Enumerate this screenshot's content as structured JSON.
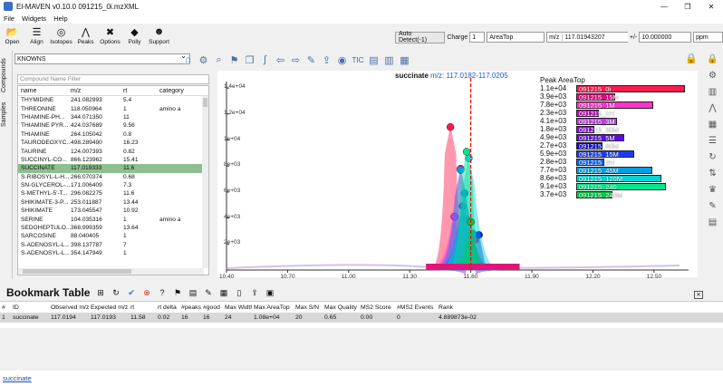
{
  "window": {
    "title": "El-MAVEN v0.10.0 091215_0i.mzXML",
    "min": "—",
    "max": "❐",
    "close": "✕"
  },
  "menu": [
    "File",
    "Widgets",
    "Help"
  ],
  "toolbar": [
    {
      "label": "Open",
      "icon": "folder-icon",
      "glyph": "📂"
    },
    {
      "label": "Align",
      "icon": "align-icon",
      "glyph": "☰"
    },
    {
      "label": "Isotopes",
      "icon": "isotope-icon",
      "glyph": "◎"
    },
    {
      "label": "Peaks",
      "icon": "peaks-icon",
      "glyph": "⋀"
    },
    {
      "label": "Options",
      "icon": "options-icon",
      "glyph": "✖"
    },
    {
      "label": "Polly",
      "icon": "polly-icon",
      "glyph": "◆"
    },
    {
      "label": "Support",
      "icon": "support-icon",
      "glyph": "☻"
    }
  ],
  "search": {
    "auto_detect": "Auto Detect(-1)",
    "charge_label": "Charge",
    "charge_value": "1",
    "peak_metric": "AreaTop",
    "mz_label": "m/z",
    "mz_value": "117.01943207",
    "tol_label": "+/-",
    "tol_value": "10.000000",
    "tol_unit": "ppm"
  },
  "left_tabs": {
    "compounds": "Compounds",
    "samples": "Samples"
  },
  "compound_panel": {
    "database": "KNOWNS",
    "filter_placeholder": "Compound Name Filter",
    "columns": [
      "name",
      "m/z",
      "rt",
      "category"
    ],
    "rows": [
      [
        "THYMIDINE",
        "241.082993",
        "5.4",
        ""
      ],
      [
        "THREONINE",
        "118.050964",
        "1",
        "amino a"
      ],
      [
        "THIAMINE-PH...",
        "344.071350",
        "11",
        ""
      ],
      [
        "THIAMINE PYR...",
        "424.037689",
        "9.56",
        ""
      ],
      [
        "THIAMINE",
        "264.105042",
        "0.8",
        ""
      ],
      [
        "TAURODEOXYC...",
        "498.289490",
        "16.23",
        ""
      ],
      [
        "TAURINE",
        "124.007393",
        "0.82",
        ""
      ],
      [
        "SUCCINYL-CO...",
        "866.123962",
        "15.41",
        ""
      ],
      [
        "SUCCINATE",
        "117.019333",
        "11.6",
        ""
      ],
      [
        "S-RIBOSYL-L-H...",
        "266.070374",
        "0.68",
        ""
      ],
      [
        "SN-GLYCEROL-...",
        "171.006409",
        "7.3",
        ""
      ],
      [
        "S-METHYL-5'-T...",
        "296.082275",
        "11.6",
        ""
      ],
      [
        "SHIKIMATE-3-P...",
        "253.011887",
        "13.44",
        ""
      ],
      [
        "SHIKIMATE",
        "173.045547",
        "10.92",
        ""
      ],
      [
        "SERINE",
        "104.035316",
        "1",
        "amino a"
      ],
      [
        "SEDOHEPTULO...",
        "368.999359",
        "13.64",
        ""
      ],
      [
        "SARCOSINE",
        "88.040405",
        "1",
        ""
      ],
      [
        "S-ADENOSYL-L...",
        "398.137787",
        "7",
        ""
      ],
      [
        "S-ADENOSYL-L...",
        "354.147949",
        "1",
        ""
      ]
    ],
    "selected_index": 8
  },
  "plot_toolbar": [
    "home-icon",
    "settings-icon",
    "zoom-icon",
    "bookmark-icon",
    "copy-icon",
    "integral-icon",
    "arrow-left-icon",
    "arrow-right-icon",
    "pencil-icon",
    "export-icon",
    "target-icon",
    "tic-icon",
    "bars-icon",
    "barsgraph-icon",
    "boxplot-icon"
  ],
  "plot_toolbar_tic": "TIC",
  "eic": {
    "title_compound": "succinate",
    "title_range": "m/z: 117.0182-117.0205",
    "legend_title": "Peak AreaTop"
  },
  "chart_data": {
    "type": "bar",
    "title": "Peak AreaTop",
    "series_name": "Peak AreaTop",
    "categories": [
      "091215_0i",
      "091215_15M",
      "091215_1M",
      "091215_1H",
      "091215_3M",
      "091215_30M",
      "091215_5M",
      "091215_60M",
      "091215_15M",
      "091215_2H",
      "091215_45M",
      "091215_120M",
      "091215_240",
      "091215_240M"
    ],
    "values": [
      11000,
      3900,
      7800,
      2300,
      4100,
      1800,
      4900,
      2700,
      5900,
      2800,
      7700,
      8600,
      9100,
      3700
    ],
    "value_labels": [
      "1.1e+04",
      "3.9e+03",
      "7.8e+03",
      "2.3e+03",
      "4.1e+03",
      "1.8e+03",
      "4.9e+03",
      "2.7e+03",
      "5.9e+03",
      "2.8e+03",
      "7.7e+03",
      "8.6e+03",
      "9.1e+03",
      "3.7e+03"
    ],
    "colors": [
      "#ff1a4d",
      "#e60080",
      "#ff33cc",
      "#cc00cc",
      "#cc33ff",
      "#9900ff",
      "#6600ff",
      "#0000ee",
      "#1a3cff",
      "#0066ff",
      "#00a0e6",
      "#00d4d4",
      "#00e68a",
      "#00cc44"
    ],
    "xlim": [
      0,
      11000
    ],
    "eic_axis": {
      "x_ticks": [
        "10.40",
        "10.70",
        "11.00",
        "11.30",
        "11.60",
        "11.90",
        "12.20",
        "12.50"
      ],
      "y_ticks": [
        "1.4e+04",
        "1.2e+04",
        "1e+04",
        "8e+03",
        "6e+03",
        "4e+03",
        "2e+03"
      ],
      "xlim": [
        10.4,
        12.67
      ],
      "ylim": [
        0,
        14500
      ],
      "marker_rt": 11.6
    }
  },
  "right_tools": [
    "lock-icon",
    "settings-icon",
    "bar-chart-icon",
    "peaks-icon",
    "grid-icon",
    "slider-icon",
    "cycle-icon",
    "sort-icon",
    "trophy-icon",
    "pencil-icon",
    "bar-chart-2-icon"
  ],
  "bookmark": {
    "title": "Bookmark Table",
    "close": "✕",
    "columns": [
      "#",
      "ID",
      "Observed m/z",
      "Expected m/z",
      "rt",
      "rt delta",
      "#peaks",
      "#good",
      "Max Width",
      "Max AreaTop",
      "Max S/N",
      "Max Quality",
      "MS2 Score",
      "#MS2 Events",
      "Rank"
    ],
    "rows": [
      [
        "1",
        "succinate",
        "117.0194",
        "117.0193",
        "11.58",
        "0.02",
        "16",
        "16",
        "24",
        "1.08e+04",
        "20",
        "0.65",
        "0.00",
        "0",
        "4.889873e-02"
      ]
    ]
  },
  "status": {
    "text": "succinate"
  }
}
